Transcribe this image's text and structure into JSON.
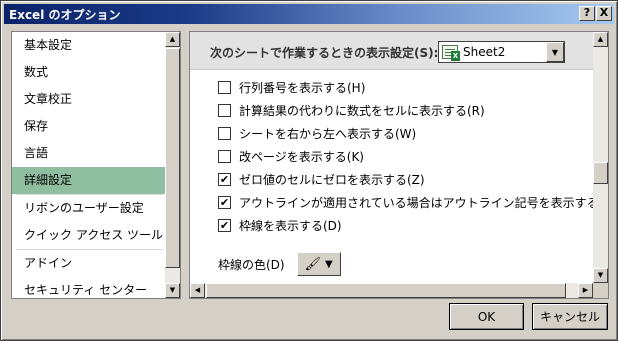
{
  "window": {
    "title": "Excel のオプション",
    "help_label": "?",
    "close_label": "X"
  },
  "sidebar": {
    "items": [
      {
        "label": "基本設定",
        "selected": false
      },
      {
        "label": "数式",
        "selected": false
      },
      {
        "label": "文章校正",
        "selected": false
      },
      {
        "label": "保存",
        "selected": false
      },
      {
        "label": "言語",
        "selected": false
      },
      {
        "label": "詳細設定",
        "selected": true
      },
      {
        "label": "リボンのユーザー設定",
        "selected": false
      },
      {
        "label": "クイック アクセス ツール バー",
        "selected": false
      },
      {
        "label": "アドイン",
        "selected": false
      },
      {
        "label": "セキュリティ センター",
        "selected": false
      }
    ]
  },
  "section": {
    "title": "次のシートで作業するときの表示設定(S):",
    "sheet_select": {
      "value": "Sheet2",
      "icon": "excel-sheet-icon"
    }
  },
  "options": [
    {
      "label": "行列番号を表示する(H)",
      "checked": false
    },
    {
      "label": "計算結果の代わりに数式をセルに表示する(R)",
      "checked": false
    },
    {
      "label": "シートを右から左へ表示する(W)",
      "checked": false
    },
    {
      "label": "改ページを表示する(K)",
      "checked": false
    },
    {
      "label": "ゼロ値のセルにゼロを表示する(Z)",
      "checked": true
    },
    {
      "label": "アウトラインが適用されている場合はアウトライン記号を表示する(O)",
      "checked": true
    },
    {
      "label": "枠線を表示する(D)",
      "checked": true
    }
  ],
  "gridline_color": {
    "label": "枠線の色(D)",
    "icon": "paint-bucket-icon"
  },
  "buttons": {
    "ok": "OK",
    "cancel": "キャンセル"
  },
  "colors": {
    "selected_bg": "#8fbfa0",
    "title_gradient_start": "#0a246a",
    "title_gradient_end": "#a6caf0"
  }
}
